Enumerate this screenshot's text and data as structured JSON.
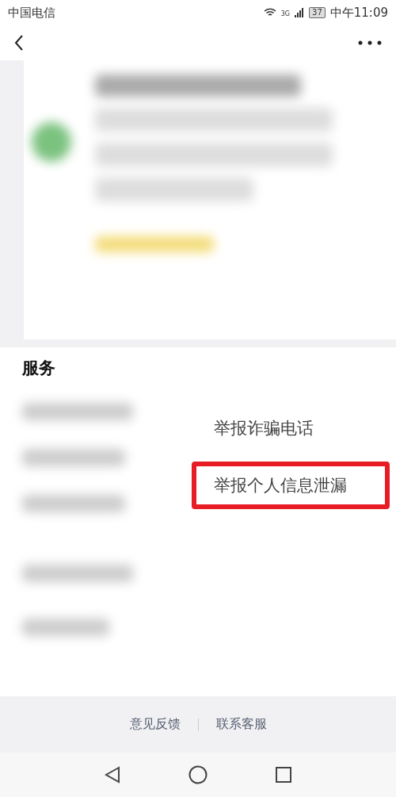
{
  "status_bar": {
    "carrier": "中国电信",
    "network": "3G",
    "battery": "37",
    "time": "中午11:09"
  },
  "services": {
    "title": "服务",
    "items": [
      {
        "label": "举报诈骗电话",
        "highlighted": false
      },
      {
        "label": "举报个人信息泄漏",
        "highlighted": true
      }
    ]
  },
  "footer_links": [
    "意见反馈",
    "联系客服"
  ]
}
